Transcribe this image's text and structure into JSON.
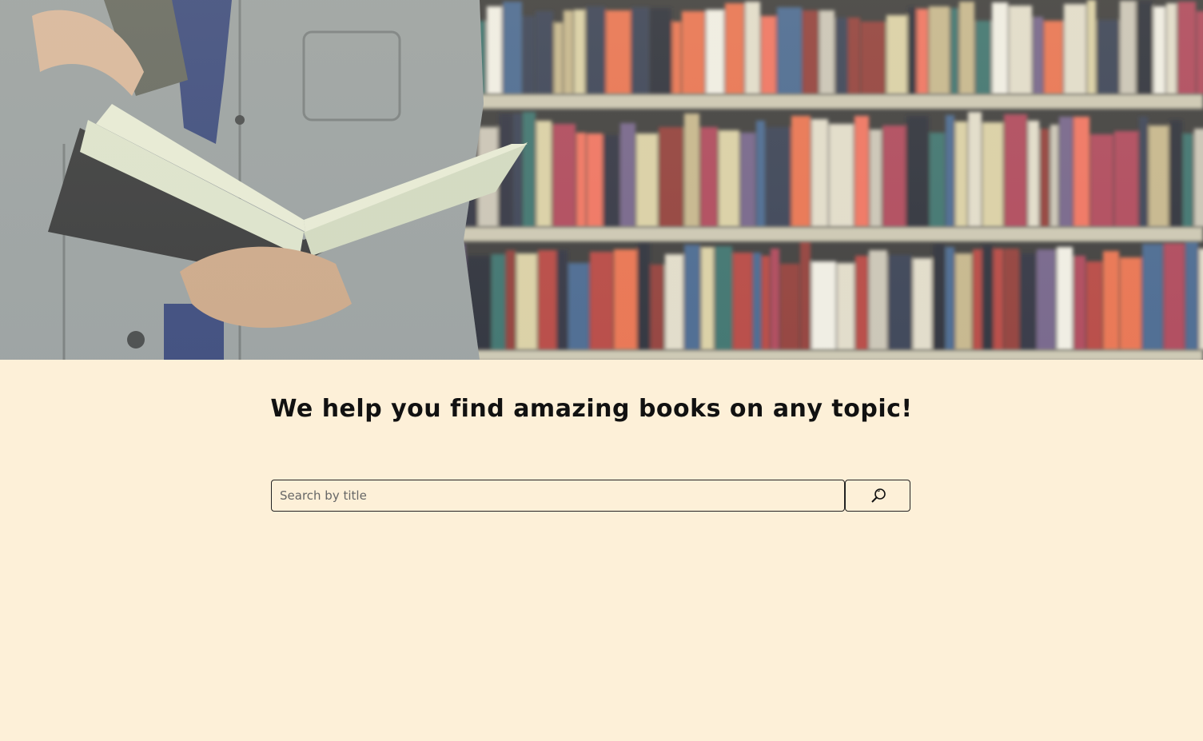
{
  "hero": {
    "image_alt": "Person reading an open book in front of library bookshelves"
  },
  "main": {
    "headline": "We help you find amazing books on any topic!"
  },
  "search": {
    "placeholder": "Search by title",
    "value": "",
    "button_icon": "search-icon"
  },
  "colors": {
    "background": "#fdf0d8",
    "text": "#111111",
    "border": "#222222"
  }
}
